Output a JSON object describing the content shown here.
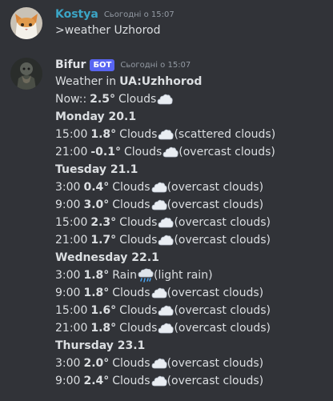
{
  "colors": {
    "background": "#313338",
    "text": "#dbdee1",
    "muted": "#949ba4",
    "kostya": "#3ba5c6",
    "bifur": "#e0e2e6",
    "badge": "#5865f2"
  },
  "messages": [
    {
      "author": "Kostya",
      "timestamp": "Сьогодні о 15:07",
      "text": ">weather Uzhorod"
    },
    {
      "author": "Bifur",
      "badge": "БОТ",
      "timestamp": "Сьогодні о 15:07",
      "title_prefix": "Weather in",
      "title_location": "UA:Uzhhorod",
      "now_label": "Now::",
      "now_temp": "2.5°",
      "now_cond": "Clouds",
      "days": [
        {
          "label": "Monday 20.1",
          "rows": [
            {
              "time": "15:00",
              "temp": "1.8°",
              "cond": "Clouds",
              "desc": "(scattered clouds)",
              "icon": "cloud-icon"
            },
            {
              "time": "21:00",
              "temp": "-0.1°",
              "cond": "Clouds",
              "desc": "(overcast clouds)",
              "icon": "cloud-icon"
            }
          ]
        },
        {
          "label": "Tuesday 21.1",
          "rows": [
            {
              "time": "3:00",
              "temp": "0.4°",
              "cond": "Clouds",
              "desc": "(overcast clouds)",
              "icon": "cloud-icon"
            },
            {
              "time": "9:00",
              "temp": "3.0°",
              "cond": "Clouds",
              "desc": "(overcast clouds)",
              "icon": "cloud-icon"
            },
            {
              "time": "15:00",
              "temp": "2.3°",
              "cond": "Clouds",
              "desc": "(overcast clouds)",
              "icon": "cloud-icon"
            },
            {
              "time": "21:00",
              "temp": "1.7°",
              "cond": "Clouds",
              "desc": "(overcast clouds)",
              "icon": "cloud-icon"
            }
          ]
        },
        {
          "label": "Wednesday 22.1",
          "rows": [
            {
              "time": "3:00",
              "temp": "1.8°",
              "cond": "Rain",
              "desc": "(light rain)",
              "icon": "rain-cloud-icon"
            },
            {
              "time": "9:00",
              "temp": "1.8°",
              "cond": "Clouds",
              "desc": "(overcast clouds)",
              "icon": "cloud-icon"
            },
            {
              "time": "15:00",
              "temp": "1.6°",
              "cond": "Clouds",
              "desc": "(overcast clouds)",
              "icon": "cloud-icon"
            },
            {
              "time": "21:00",
              "temp": "1.8°",
              "cond": "Clouds",
              "desc": "(overcast clouds)",
              "icon": "cloud-icon"
            }
          ]
        },
        {
          "label": "Thursday 23.1",
          "rows": [
            {
              "time": "3:00",
              "temp": "2.0°",
              "cond": "Clouds",
              "desc": "(overcast clouds)",
              "icon": "cloud-icon"
            },
            {
              "time": "9:00",
              "temp": "2.4°",
              "cond": "Clouds",
              "desc": "(overcast clouds)",
              "icon": "cloud-icon"
            }
          ]
        }
      ]
    }
  ]
}
